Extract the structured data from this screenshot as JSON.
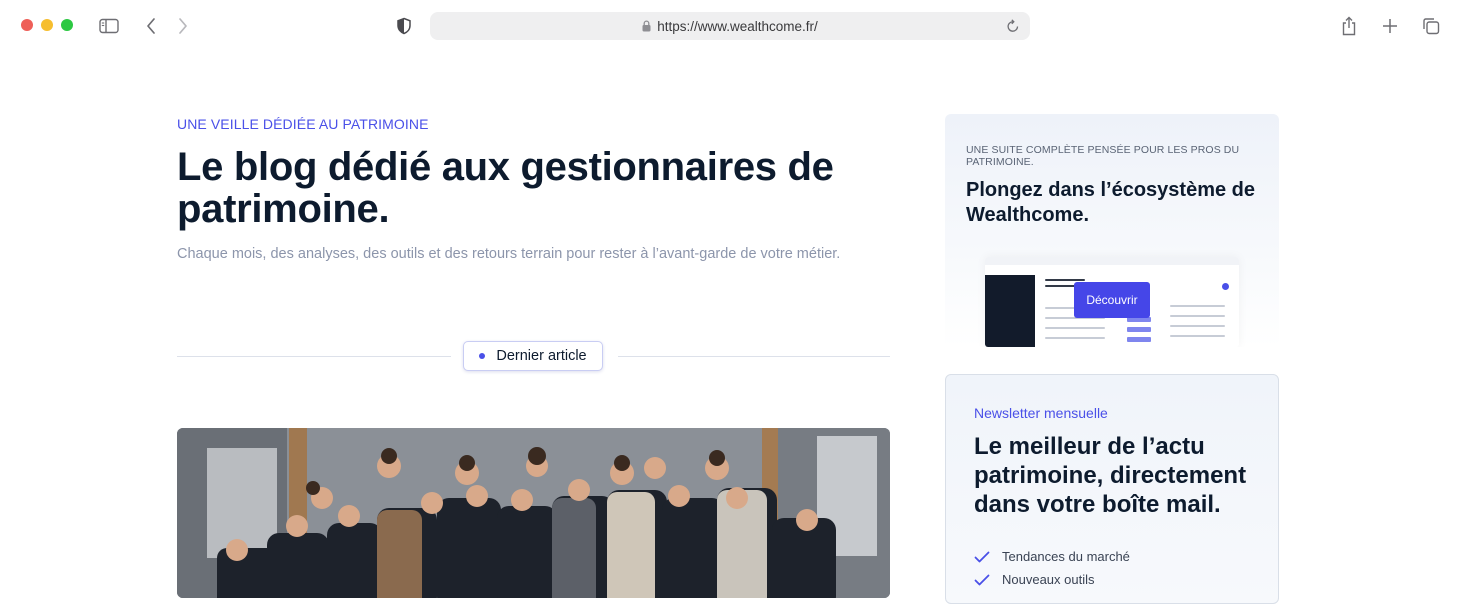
{
  "browser": {
    "url": "https://www.wealthcome.fr/",
    "icons": [
      "sidebar-icon",
      "back-icon",
      "forward-icon",
      "shield-icon",
      "lock-icon",
      "reload-icon",
      "share-icon",
      "new-tab-icon",
      "tabs-overview-icon"
    ]
  },
  "hero": {
    "eyebrow": "UNE VEILLE DÉDIÉE AU PATRIMOINE",
    "title": "Le blog dédié aux gestionnaires de patrimoine.",
    "subtitle": "Chaque mois, des analyses, des outils et des retours terrain pour rester à l’avant-garde de votre métier."
  },
  "latest": {
    "label": "Dernier article"
  },
  "promo": {
    "eyebrow": "UNE SUITE COMPLÈTE PENSÉE POUR LES PROS DU PATRIMOINE.",
    "title": "Plongez dans l’écosystème de Wealthcome.",
    "button": "Découvrir"
  },
  "newsletter": {
    "eyebrow": "Newsletter mensuelle",
    "title": "Le meilleur de l’actu patrimoine, directement dans votre boîte mail.",
    "items": [
      "Tendances du marché",
      "Nouveaux outils"
    ]
  },
  "colors": {
    "accent": "#4a50e8",
    "button": "#4546e8",
    "heading": "#0d1b2e",
    "muted": "#8c95ab"
  }
}
